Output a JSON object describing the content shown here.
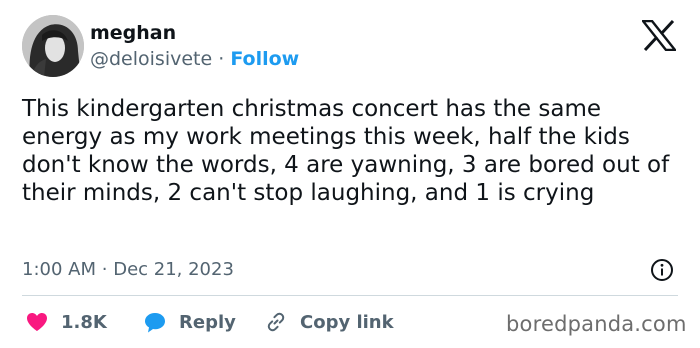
{
  "author": {
    "name": "meghan",
    "handle": "@deloisivete",
    "separator": "·",
    "follow_label": "Follow"
  },
  "tweet": {
    "text": "This kindergarten christmas concert has the same energy as my work meetings this week, half the kids don't know the words, 4 are yawning, 3 are bored out of their minds, 2 can't stop laughing, and 1 is crying",
    "time": "1:00 AM",
    "date_separator": "·",
    "date": "Dec 21, 2023"
  },
  "actions": {
    "like_count": "1.8K",
    "reply_label": "Reply",
    "copy_link_label": "Copy link"
  },
  "icons": {
    "brand": "x-logo-icon",
    "like": "heart-icon",
    "reply": "speech-bubble-icon",
    "copy": "link-icon",
    "info": "info-icon"
  },
  "colors": {
    "accent": "#1d9bf0",
    "heart": "#f91880",
    "text": "#0f1419",
    "muted": "#536471",
    "divider": "#cfd9de"
  },
  "watermark": "boredpanda.com"
}
